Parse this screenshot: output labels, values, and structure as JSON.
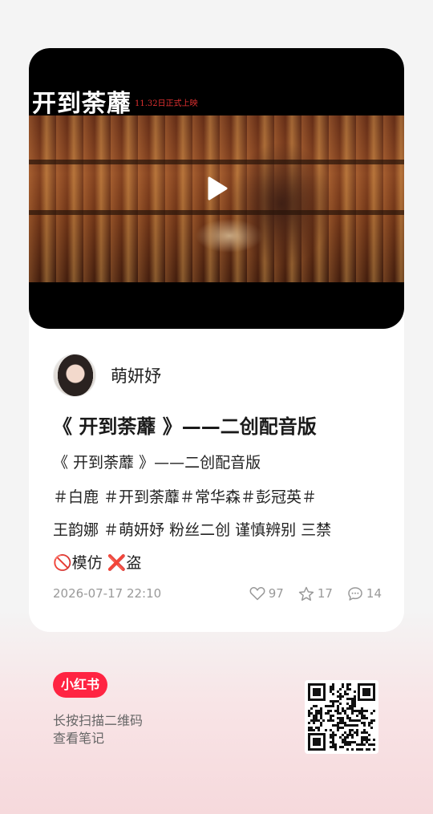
{
  "video": {
    "title_overlay": "开到荼蘼",
    "subtitle_overlay": "11.32日正式上映"
  },
  "author": {
    "name": "萌妍妤"
  },
  "post": {
    "title": "《 开到荼蘼 》——二创配音版",
    "subtitle": "《 开到荼蘼 》——二创配音版",
    "body_lines": [
      "＃白鹿 ＃开到荼蘼＃常华森＃彭冠英＃",
      "王韵娜 ＃萌妍妤  粉丝二创 谨慎辨别 三禁",
      "🚫模仿 ❌盗"
    ]
  },
  "meta": {
    "date": "2026-07-17 22:10",
    "likes": "97",
    "favorites": "17",
    "comments": "14"
  },
  "footer": {
    "logo": "小红书",
    "hint_line1": "长按扫描二维码",
    "hint_line2": "查看笔记"
  },
  "icons": {
    "play": "play-icon",
    "like": "heart-icon",
    "favorite": "star-icon",
    "comment": "comment-icon",
    "qr": "qr-code"
  },
  "colors": {
    "brand": "#ff2442",
    "overlay_subtitle": "#e03030",
    "meta_text": "#999999"
  }
}
